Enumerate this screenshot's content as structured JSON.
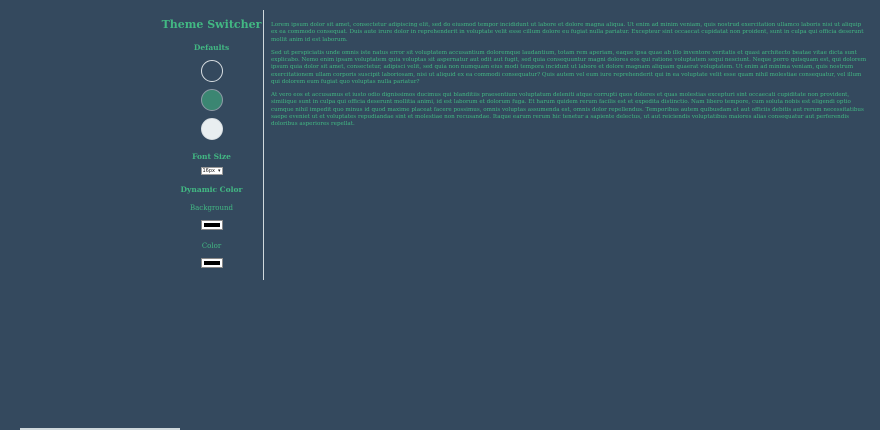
{
  "sidebar": {
    "title": "Theme Switcher",
    "defaults_heading": "Defaults",
    "font_size_heading": "Font Size",
    "font_size_select": "16px",
    "dynamic_color_heading": "Dynamic Color",
    "background_label": "Background",
    "color_label": "Color"
  },
  "content": {
    "paragraphs": [
      "Lorem ipsum dolor sit amet, consectetur adipiscing elit, sed do eiusmod tempor incididunt ut labore et dolore magna aliqua. Ut enim ad minim veniam, quis nostrud exercitation ullamco laboris nisi ut aliquip ex ea commodo consequat. Duis aute irure dolor in reprehenderit in voluptate velit esse cillum dolore eu fugiat nulla pariatur. Excepteur sint occaecat cupidatat non proident, sunt in culpa qui officia deserunt mollit anim id est laborum.",
      "Sed ut perspiciatis unde omnis iste natus error sit voluptatem accusantium doloremque laudantium, totam rem aperiam, eaque ipsa quae ab illo inventore veritatis et quasi architecto beatae vitae dicta sunt explicabo. Nemo enim ipsam voluptatem quia voluptas sit aspernatur aut odit aut fugit, sed quia consequuntur magni dolores eos qui ratione voluptatem sequi nesciunt. Neque porro quisquam est, qui dolorem ipsum quia dolor sit amet, consectetur, adipisci velit, sed quia non numquam eius modi tempora incidunt ut labore et dolore magnam aliquam quaerat voluptatem. Ut enim ad minima veniam, quis nostrum exercitationem ullam corporis suscipit laboriosam, nisi ut aliquid ex ea commodi consequatur? Quis autem vel eum iure reprehenderit qui in ea voluptate velit esse quam nihil molestiae consequatur, vel illum qui dolorem eum fugiat quo voluptas nulla pariatur?",
      "At vero eos et accusamus et iusto odio dignissimos ducimus qui blanditiis praesentium voluptatum deleniti atque corrupti quos dolores et quas molestias excepturi sint occaecati cupiditate non provident, similique sunt in culpa qui officia deserunt mollitia animi, id est laborum et dolorum fuga. Et harum quidem rerum facilis est et expedita distinctio. Nam libero tempore, cum soluta nobis est eligendi optio cumque nihil impedit quo minus id quod maxime placeat facere possimus, omnis voluptas assumenda est, omnis dolor repellendus. Temporibus autem quibusdam et aut officiis debitis aut rerum necessitatibus saepe eveniet ut et voluptates repudiandae sint et molestiae non recusandae. Itaque earum rerum hic tenetur a sapiente delectus, ut aut reiciendis voluptatibus maiores alias consequatur aut perferendis doloribus asperiores repellat."
    ]
  },
  "colors": {
    "background": "#34495e",
    "accent": "#42b883",
    "divider": "#cfd8dc",
    "default_swatch_1": "#34495e",
    "default_swatch_2": "#42b883",
    "default_swatch_3": "#e9eef0"
  }
}
